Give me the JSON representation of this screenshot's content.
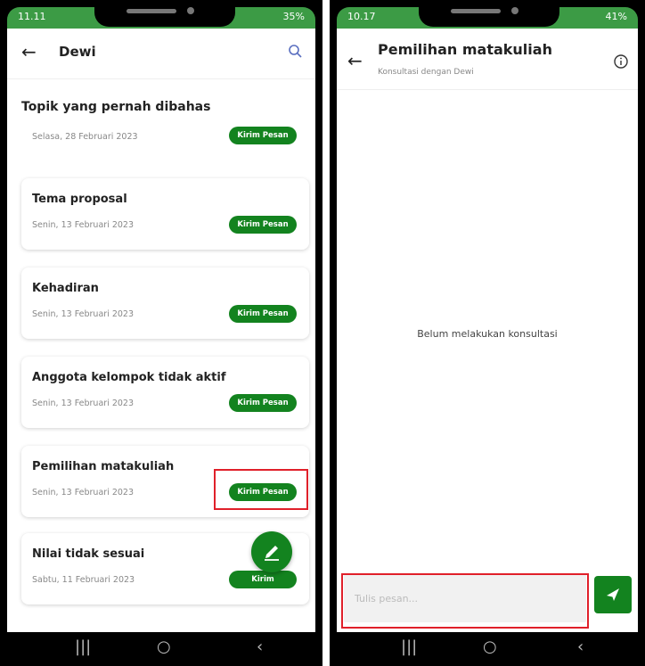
{
  "left": {
    "status": {
      "time": "11.11",
      "battery": "35%"
    },
    "header": {
      "title": "Dewi"
    },
    "topics": [
      {
        "title": "Topik yang pernah dibahas",
        "date": "Selasa, 28 Februari 2023",
        "button": "Kirim Pesan"
      },
      {
        "title": "Tema proposal",
        "date": "Senin, 13 Februari 2023",
        "button": "Kirim Pesan"
      },
      {
        "title": "Kehadiran",
        "date": "Senin, 13 Februari 2023",
        "button": "Kirim Pesan"
      },
      {
        "title": "Anggota kelompok tidak aktif",
        "date": "Senin, 13 Februari 2023",
        "button": "Kirim Pesan"
      },
      {
        "title": "Pemilihan matakuliah",
        "date": "Senin, 13 Februari 2023",
        "button": "Kirim Pesan"
      },
      {
        "title": "Nilai tidak sesuai",
        "date": "Sabtu, 11 Februari 2023",
        "button": "Kirim"
      }
    ]
  },
  "right": {
    "status": {
      "time": "10.17",
      "battery": "41%"
    },
    "header": {
      "title": "Pemilihan matakuliah",
      "subtitle": "Konsultasi dengan Dewi"
    },
    "empty_message": "Belum melakukan konsultasi",
    "input": {
      "placeholder": "Tulis pesan..."
    }
  },
  "navbar": {
    "recent": "|||",
    "home": "○",
    "back": "‹"
  },
  "colors": {
    "accent": "#13831f",
    "statusbar": "#3c9b45",
    "highlight": "#e0202a"
  }
}
